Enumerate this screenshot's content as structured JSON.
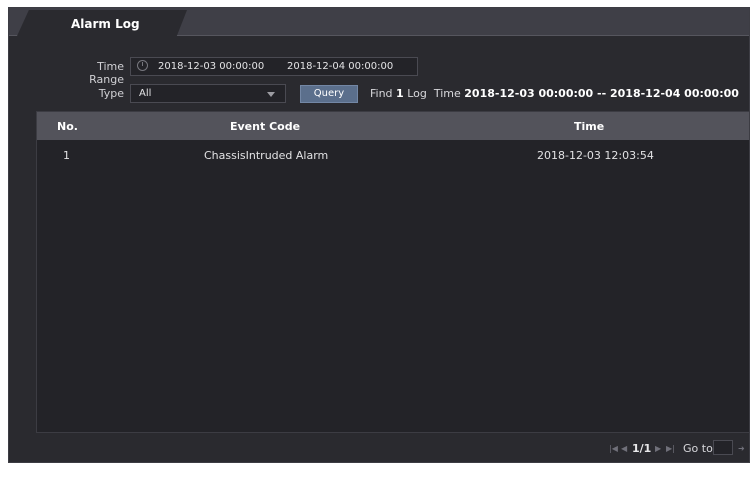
{
  "tab": {
    "title": "Alarm Log"
  },
  "filters": {
    "time_range_label": "Time Range",
    "start_time": "2018-12-03 00:00:00",
    "end_time": "2018-12-04 00:00:00",
    "type_label": "Type",
    "type_value": "All",
    "query_label": "Query"
  },
  "result": {
    "find_prefix": "Find",
    "count": "1",
    "log_word": "Log",
    "time_word": "Time",
    "range_text": "2018-12-03 00:00:00 -- 2018-12-04 00:00:00"
  },
  "table": {
    "columns": [
      "No.",
      "Event Code",
      "Time"
    ],
    "rows": [
      [
        "1",
        "ChassisIntruded Alarm",
        "2018-12-03 12:03:54"
      ]
    ]
  },
  "pagination": {
    "page_text": "1/1",
    "goto_label": "Go to",
    "icons": [
      "first-page-icon",
      "prev-page-icon",
      "next-page-icon",
      "last-page-icon",
      "go-arrow-icon"
    ]
  },
  "colors": {
    "panel_bg": "#2a2a2f",
    "table_header_bg": "#53535b",
    "query_button": "#5b6f8c"
  }
}
